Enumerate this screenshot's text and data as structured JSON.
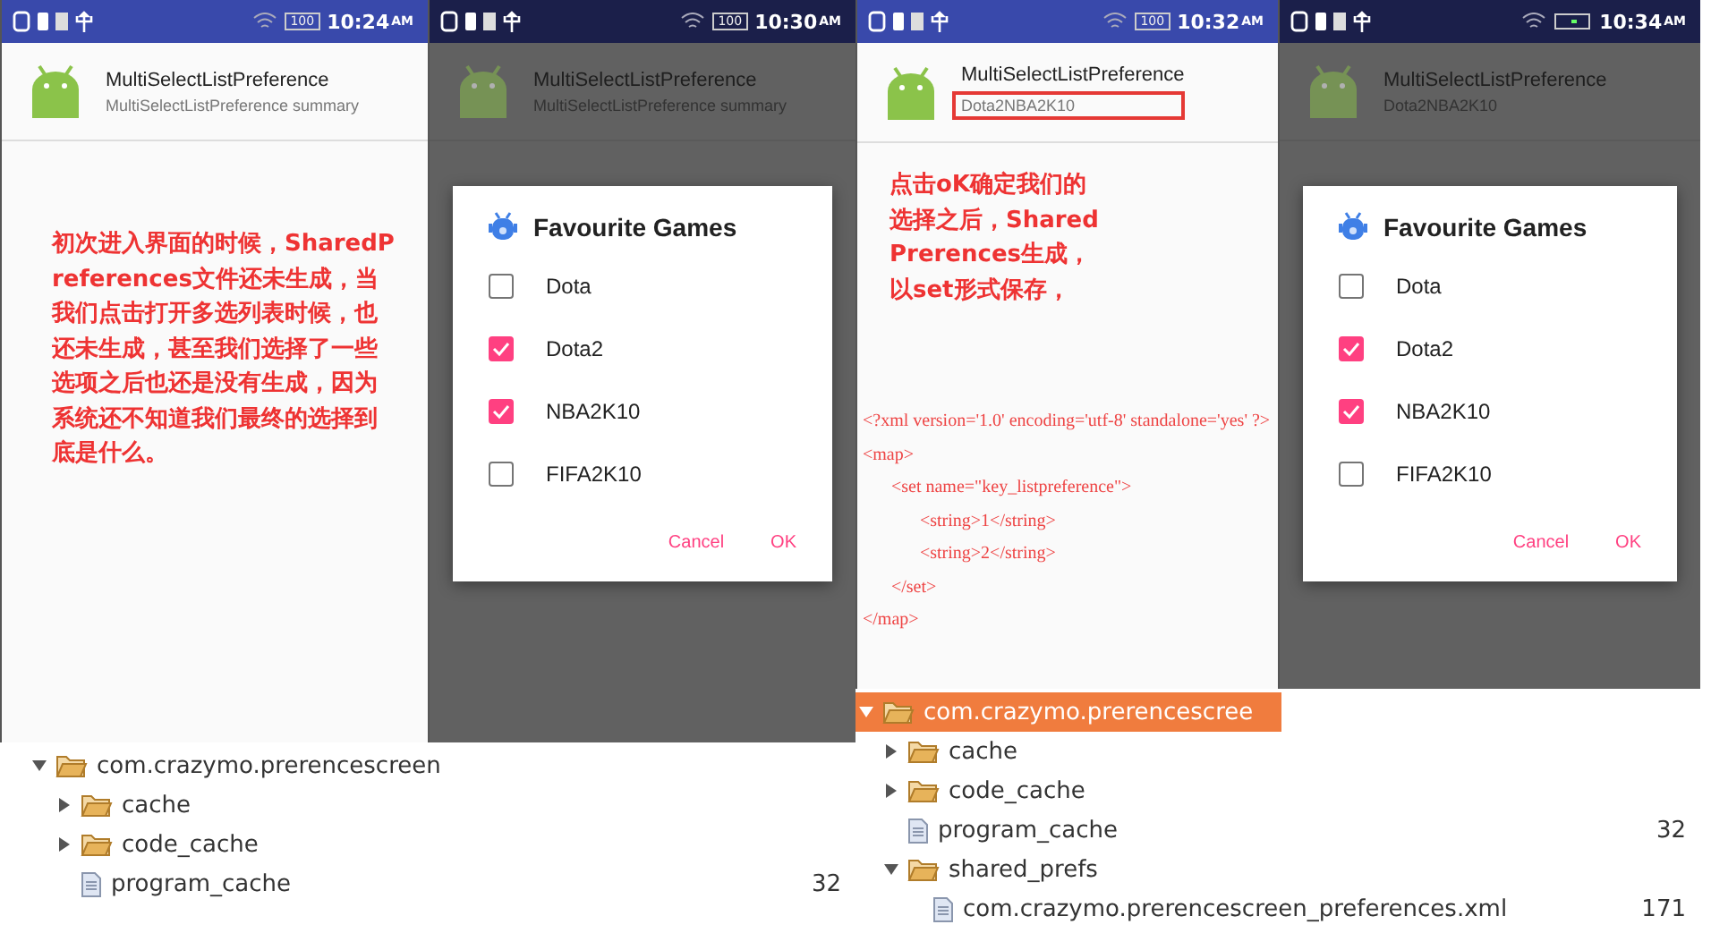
{
  "halves": [
    {
      "panels": [
        {
          "time": "10:24",
          "ampm": "AM",
          "battery": "100",
          "dimmed": false,
          "title": "MultiSelectListPreference",
          "summary": "MultiSelectListPreference summary",
          "summary_highlighted": false,
          "annotation": "初次进入界面的时候，SharedPreferences文件还未生成，当我们点击打开多选列表时候，也还未生成，甚至我们选择了一些选项之后也还是没有生成，因为系统还不知道我们最终的选择到底是什么。"
        },
        {
          "time": "10:30",
          "ampm": "AM",
          "battery": "100",
          "dimmed": true,
          "title": "MultiSelectListPreference",
          "summary": "MultiSelectListPreference summary",
          "summary_highlighted": false,
          "dialog": {
            "title": "Favourite Games",
            "options": [
              {
                "label": "Dota",
                "checked": false
              },
              {
                "label": "Dota2",
                "checked": true
              },
              {
                "label": "NBA2K10",
                "checked": true
              },
              {
                "label": "FIFA2K10",
                "checked": false
              }
            ],
            "buttons": [
              "Cancel",
              "OK"
            ]
          }
        }
      ],
      "tree": [
        {
          "name": "com.crazymo.prerencescreen",
          "kind": "folder",
          "expanded": true,
          "selected": false,
          "children": [
            {
              "name": "cache",
              "kind": "folder",
              "expanded": false,
              "selected": false
            },
            {
              "name": "code_cache",
              "kind": "folder",
              "expanded": false,
              "selected": false
            },
            {
              "name": "program_cache",
              "kind": "file",
              "size": "32",
              "selected": false
            }
          ]
        }
      ]
    },
    {
      "panels": [
        {
          "time": "10:32",
          "ampm": "AM",
          "battery": "100",
          "dimmed": false,
          "title": "MultiSelectListPreference",
          "summary": "Dota2NBA2K10",
          "summary_highlighted": true,
          "annotation": "点击oK确定我们的选择之后，SharedPrerences生成，以set形式保存，",
          "xml": [
            {
              "text": "<?xml version='1.0' encoding='utf-8' standalone='yes' ?>"
            },
            {
              "text": "<map>",
              "children": [
                {
                  "text": "<set name=\"key_listpreference\">",
                  "children": [
                    {
                      "text": "<string>1</string>"
                    },
                    {
                      "text": "<string>2</string>"
                    }
                  ]
                },
                {
                  "text": "</set>"
                }
              ]
            },
            {
              "text": "</map>"
            }
          ]
        },
        {
          "time": "10:34",
          "ampm": "AM",
          "dimmed": true,
          "title": "MultiSelectListPreference",
          "summary": "Dota2NBA2K10",
          "summary_highlighted": false,
          "dialog": {
            "title": "Favourite Games",
            "options": [
              {
                "label": "Dota",
                "checked": false
              },
              {
                "label": "Dota2",
                "checked": true
              },
              {
                "label": "NBA2K10",
                "checked": true
              },
              {
                "label": "FIFA2K10",
                "checked": false
              }
            ],
            "buttons": [
              "Cancel",
              "OK"
            ]
          }
        }
      ],
      "tree": [
        {
          "name": "com.crazymo.prerencescree",
          "kind": "folder",
          "expanded": true,
          "selected": true,
          "children": [
            {
              "name": "cache",
              "kind": "folder",
              "expanded": false,
              "selected": false
            },
            {
              "name": "code_cache",
              "kind": "folder",
              "expanded": false,
              "selected": false
            },
            {
              "name": "program_cache",
              "kind": "file",
              "size": "32",
              "selected": false
            },
            {
              "name": "shared_prefs",
              "kind": "folder",
              "expanded": true,
              "selected": false,
              "children": [
                {
                  "name": "com.crazymo.prerencescreen_preferences.xml",
                  "kind": "file",
                  "size": "171",
                  "selected": false
                }
              ]
            }
          ]
        }
      ]
    }
  ]
}
